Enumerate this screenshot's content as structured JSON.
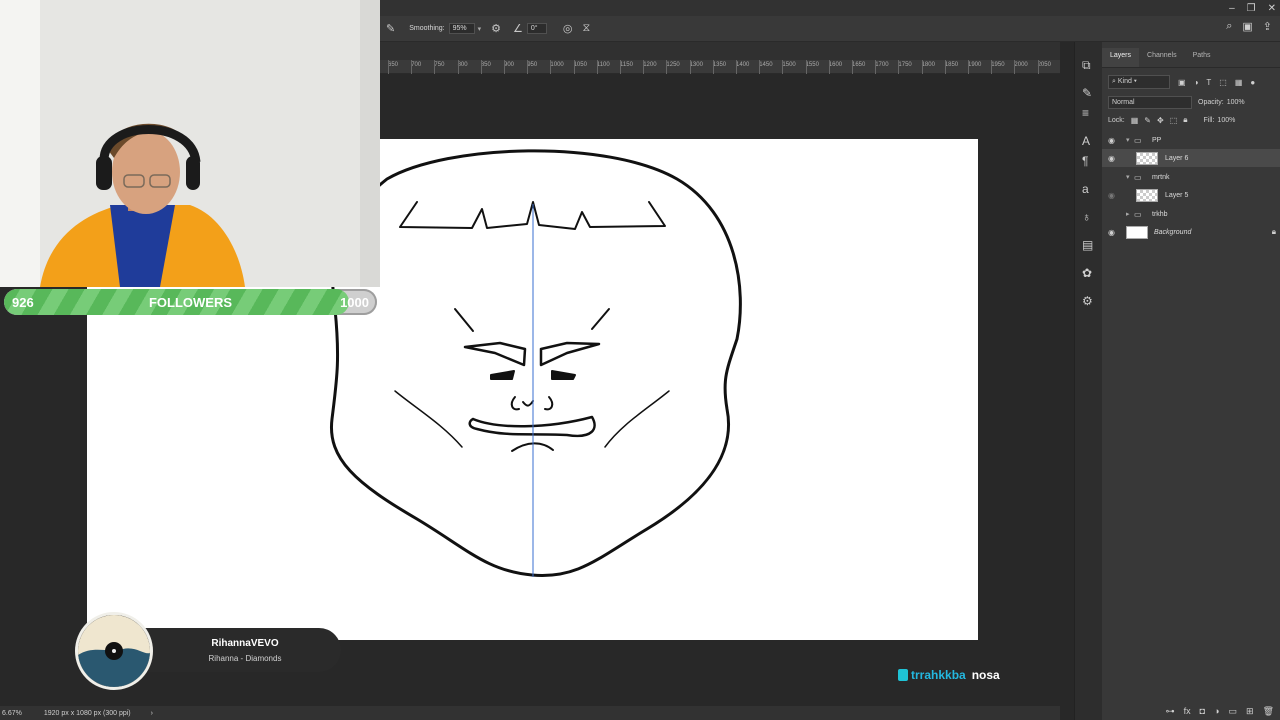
{
  "followers": {
    "current": "926",
    "label": "FOLLOWERS",
    "goal": "1000",
    "progress_fraction": 0.926
  },
  "options_bar": {
    "smoothing_label": "Smoothing:",
    "smoothing_value": "95%",
    "angle_value": "0°"
  },
  "ruler": {
    "ticks": [
      "650",
      "700",
      "750",
      "800",
      "850",
      "900",
      "950",
      "1000",
      "1050",
      "1100",
      "1150",
      "1200",
      "1250",
      "1300",
      "1350",
      "1400",
      "1450",
      "1500",
      "1550",
      "1600",
      "1650",
      "1700",
      "1750",
      "1800",
      "1850",
      "1900",
      "1950",
      "2000",
      "2050"
    ]
  },
  "layers_panel": {
    "tabs": [
      "Layers",
      "Channels",
      "Paths"
    ],
    "kind_label": "Kind",
    "blend_mode": "Normal",
    "opacity_label": "Opacity:",
    "opacity_value": "100%",
    "lock_label": "Lock:",
    "fill_label": "Fill:",
    "fill_value": "100%",
    "layers": [
      {
        "name": "PP",
        "type": "group"
      },
      {
        "name": "Layer 6",
        "type": "layer"
      },
      {
        "name": "mrtnk",
        "type": "group"
      },
      {
        "name": "Layer 5",
        "type": "layer"
      },
      {
        "name": "trkhb",
        "type": "group"
      },
      {
        "name": "Background",
        "type": "background"
      }
    ]
  },
  "music": {
    "artist": "RihannaVEVO",
    "track": "Rihanna - Diamonds"
  },
  "watermark": {
    "username": "trrahkkba",
    "tag": "nosa"
  },
  "status_bar": {
    "zoom": "6.67%",
    "doc_info": "1920 px x 1080 px (300 ppi)",
    "arrow": "›"
  },
  "colors": {
    "accent_green": "#58b85a",
    "watermark_blue": "#24b8e0",
    "guide_line": "#3a6fd0"
  },
  "icons": {
    "window_controls": [
      "minimize-icon",
      "restore-icon",
      "close-icon"
    ]
  }
}
